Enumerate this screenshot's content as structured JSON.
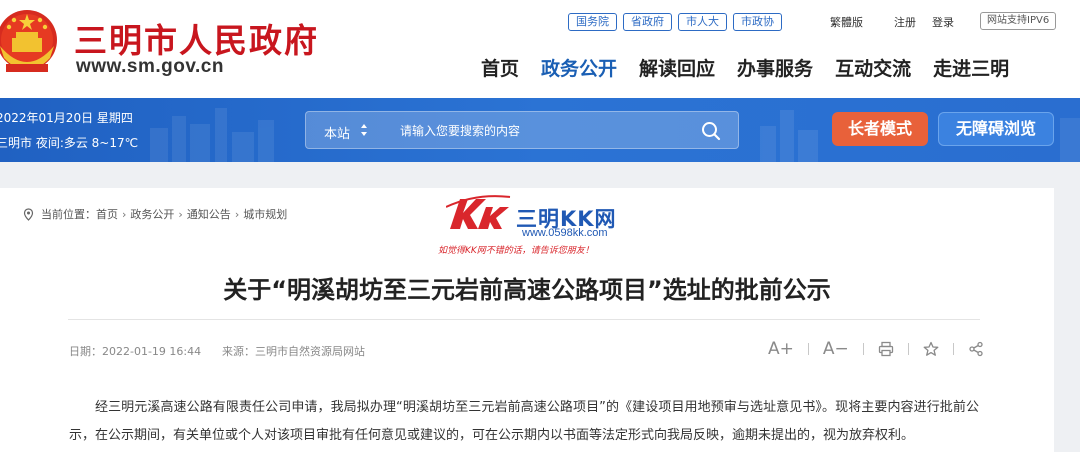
{
  "header": {
    "title": "三明市人民政府",
    "url": "www.sm.gov.cn",
    "top_pills": [
      "国务院",
      "省政府",
      "市人大",
      "市政协"
    ],
    "traditional": "繁體版",
    "register": "注册",
    "login": "登录",
    "ipv6": "网站支持IPV6",
    "nav": [
      "首页",
      "政务公开",
      "解读回应",
      "办事服务",
      "互动交流",
      "走进三明"
    ],
    "active_nav": "政务公开"
  },
  "band": {
    "date": "2022年01月20日 星期四",
    "weather": "三明市 夜间:多云 8~17℃",
    "search_scope": "本站",
    "search_placeholder": "请输入您要搜索的内容",
    "elder_mode": "长者模式",
    "accessible": "无障碍浏览"
  },
  "breadcrumb": {
    "prefix": "当前位置：",
    "items": [
      "首页",
      "政务公开",
      "通知公告",
      "城市规划"
    ],
    "separator": "›"
  },
  "watermark": {
    "name": "三明KK网",
    "url": "www.0598kk.com",
    "slogan": "如觉得KK网不错的话，请告诉您朋友！"
  },
  "article": {
    "title": "关于“明溪胡坊至三元岩前高速公路项目”选址的批前公示",
    "date": "日期：2022-01-19 16:44",
    "source": "来源：三明市自然资源局网站",
    "font_larger": "A+",
    "font_smaller": "A−",
    "body": "经三明元溪高速公路有限责任公司申请，我局拟办理“明溪胡坊至三元岩前高速公路项目”的《建设项目用地预审与选址意见书》。现将主要内容进行批前公示，在公示期间，有关单位或个人对该项目审批有任何意见或建议的，可在公示期内以书面等法定形式向我局反映，逾期未提出的，视为放弃权利。"
  },
  "colors": {
    "brand_red": "#c8161e",
    "nav_active": "#1a5fb4",
    "band_blue": "#2b73d4",
    "elder_button": "#e8613a",
    "watermark_blue": "#2059b4"
  },
  "icons": [
    "national-emblem-icon",
    "location-icon",
    "search-icon",
    "scope-caret-icon",
    "print-icon",
    "star-icon",
    "share-icon"
  ]
}
